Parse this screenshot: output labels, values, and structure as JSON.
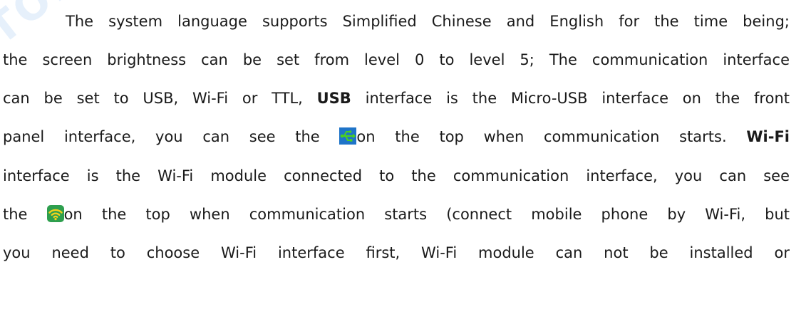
{
  "watermark": "TOPDON",
  "paragraph": {
    "line1": "The system language supports Simplified Chinese and English for the time being;",
    "line2": "the screen brightness can be set from level 0 to level 5; The communication interface",
    "line3_a": "can be set to USB, Wi-Fi or TTL, ",
    "line3_bold": "USB",
    "line3_b": " interface is the Micro-USB interface on the front",
    "line4_a": "panel interface, you can see the ",
    "line4_b": "on the top when communication starts. ",
    "line4_bold": "Wi-Fi",
    "line5": "interface is the Wi-Fi module connected to the communication interface, you can see",
    "line6_a": "the ",
    "line6_b": "on the top when communication starts (connect mobile phone by Wi-Fi, but",
    "line7": "you need to choose Wi-Fi interface first, Wi-Fi module can not be installed or"
  },
  "icons": {
    "usb": "usb-icon",
    "wifi": "wifi-icon"
  },
  "colors": {
    "usb_bg": "#1f74c8",
    "usb_symbol": "#4cd11e",
    "wifi_bg": "#2e9f4e",
    "wifi_symbol": "#f4d21c",
    "watermark": "#8cb9eb"
  }
}
